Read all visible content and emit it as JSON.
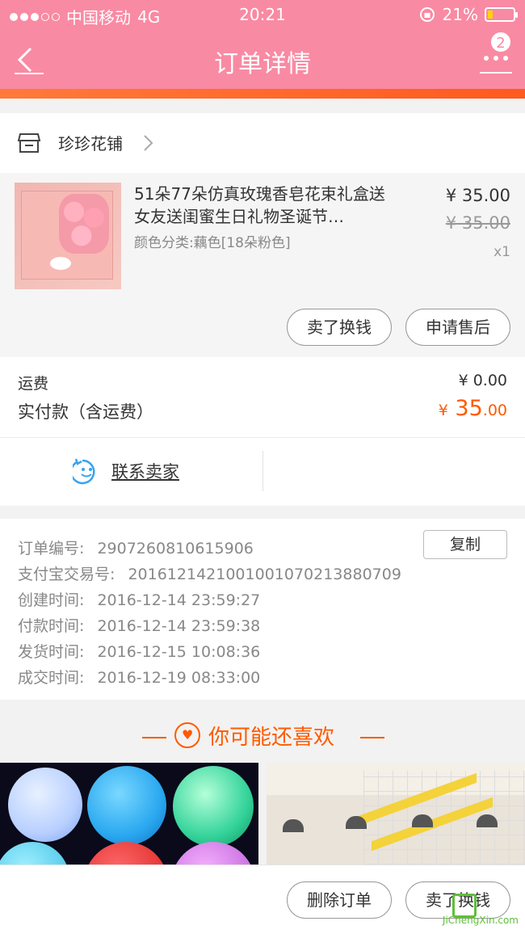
{
  "statusbar": {
    "carrier": "中国移动",
    "network": "4G",
    "time": "20:21",
    "battery": "21%",
    "battery_level": 0.21
  },
  "header": {
    "title": "订单详情",
    "badge": "2",
    "accent": "#f98aa3"
  },
  "shop": {
    "name": "珍珍花铺"
  },
  "product": {
    "title": "51朵77朵仿真玫瑰香皂花束礼盒送女友送闺蜜生日礼物圣诞节…",
    "spec": "颜色分类:藕色[18朵粉色]",
    "price": "¥ 35.00",
    "original_price": "¥ 35.00",
    "quantity": "x1",
    "buttons": [
      "卖了换钱",
      "申请售后"
    ]
  },
  "fees": {
    "shipping_label": "运费",
    "shipping_value": "¥ 0.00",
    "paid_label": "实付款（含运费）",
    "paid_currency": "¥",
    "paid_int": "35",
    "paid_dec": ".00"
  },
  "contact": {
    "label": "联系卖家"
  },
  "order_info": {
    "copy_label": "复制",
    "rows": [
      {
        "label": "订单编号:",
        "value": "2907260810615906"
      },
      {
        "label": "支付宝交易号:",
        "value": "2016121421001001070213880709"
      },
      {
        "label": "创建时间:",
        "value": "2016-12-14 23:59:27"
      },
      {
        "label": "付款时间:",
        "value": "2016-12-14 23:59:38"
      },
      {
        "label": "发货时间:",
        "value": "2016-12-15 10:08:36"
      },
      {
        "label": "成交时间:",
        "value": "2016-12-19 08:33:00"
      }
    ]
  },
  "recommend": {
    "title": "你可能还喜欢"
  },
  "bottom": {
    "buttons": [
      "删除订单",
      "卖了换钱"
    ]
  },
  "watermark": {
    "text": "JiChengXin.com"
  },
  "icons": [
    "back-arrow-icon",
    "more-icon",
    "shop-icon",
    "chevron-right-icon",
    "smile-chat-icon",
    "heart-icon"
  ],
  "colors": {
    "header": "#f98aa3",
    "accent": "#ff5a00",
    "watermark": "#5fbf3b"
  }
}
